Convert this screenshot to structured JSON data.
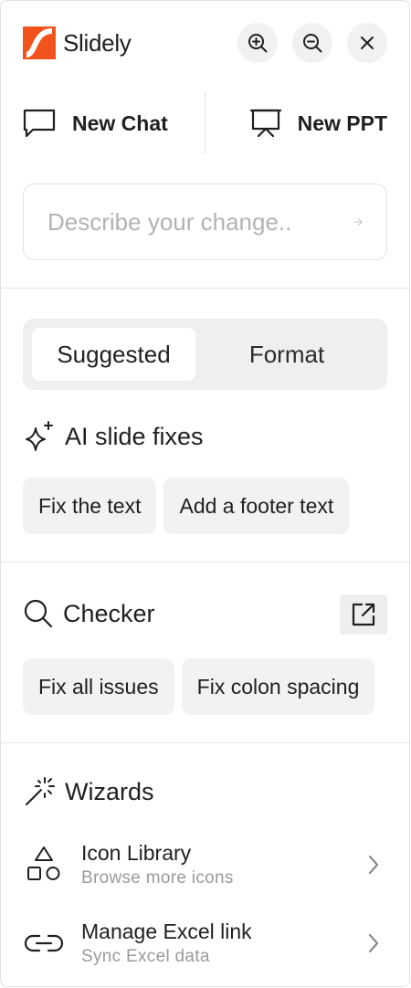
{
  "brand": {
    "name": "Slidely",
    "accent": "#f0531c"
  },
  "header": {
    "zoom_in_icon": "zoom-in-icon",
    "zoom_out_icon": "zoom-out-icon",
    "close_icon": "close-icon"
  },
  "actions": {
    "new_chat": "New Chat",
    "new_ppt": "New PPT"
  },
  "input": {
    "placeholder": "Describe your change.."
  },
  "tabs": [
    {
      "label": "Suggested",
      "active": true
    },
    {
      "label": "Format",
      "active": false
    }
  ],
  "ai_fixes": {
    "title": "AI slide fixes",
    "chips": [
      "Fix the text",
      "Add a footer text"
    ]
  },
  "checker": {
    "title": "Checker",
    "chips": [
      "Fix all issues",
      "Fix colon spacing"
    ]
  },
  "wizards": {
    "title": "Wizards",
    "items": [
      {
        "title": "Icon Library",
        "subtitle": "Browse more icons"
      },
      {
        "title": "Manage Excel link",
        "subtitle": "Sync Excel data"
      }
    ]
  }
}
